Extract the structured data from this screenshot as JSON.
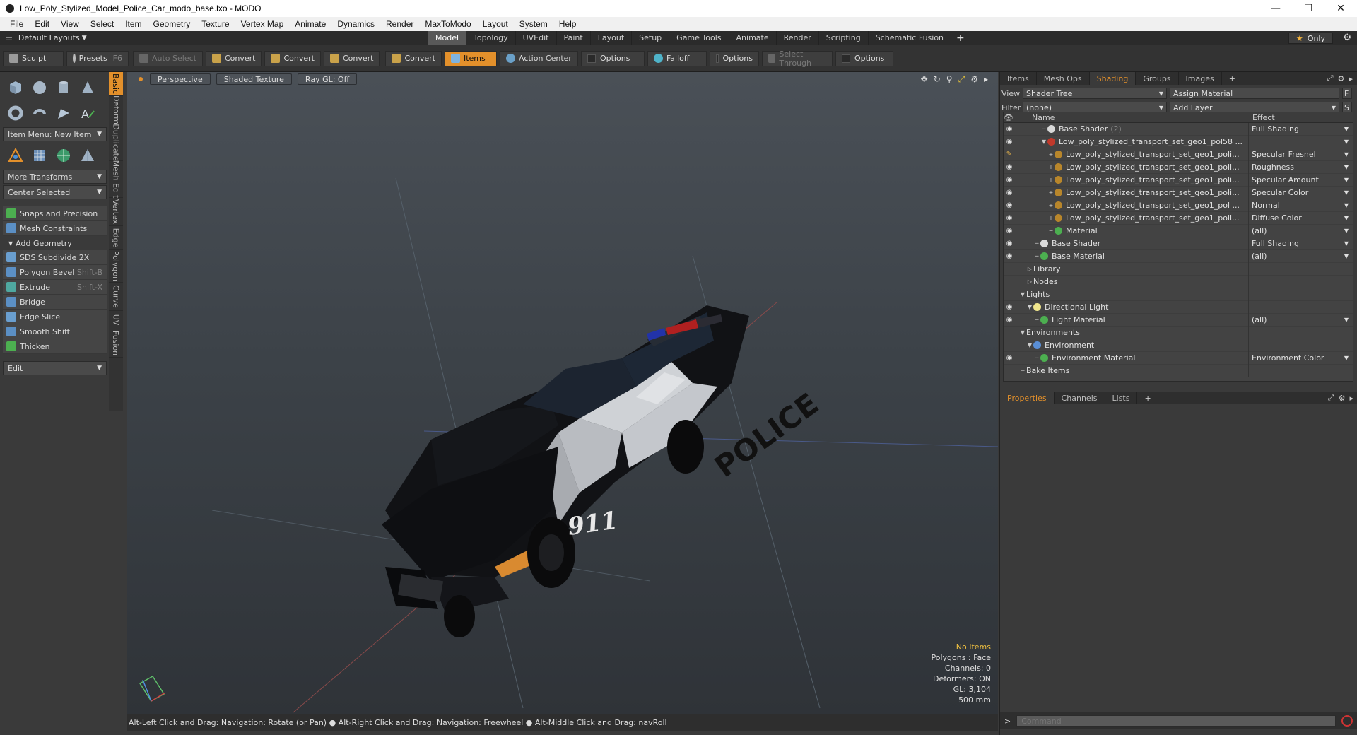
{
  "window": {
    "title": "Low_Poly_Stylized_Model_Police_Car_modo_base.lxo - MODO"
  },
  "menu": [
    "File",
    "Edit",
    "View",
    "Select",
    "Item",
    "Geometry",
    "Texture",
    "Vertex Map",
    "Animate",
    "Dynamics",
    "Render",
    "MaxToModo",
    "Layout",
    "System",
    "Help"
  ],
  "layoutbar": {
    "layouts_label": "Default Layouts",
    "tabs": [
      "Model",
      "Topology",
      "UVEdit",
      "Paint",
      "Layout",
      "Setup",
      "Game Tools",
      "Animate",
      "Render",
      "Scripting",
      "Schematic Fusion"
    ],
    "active_tab": "Model",
    "only_label": "Only"
  },
  "toolbar": {
    "sculpt": "Sculpt",
    "presets": "Presets",
    "presets_key": "F6",
    "auto_select": "Auto Select",
    "convert1": "Convert",
    "convert2": "Convert",
    "convert3": "Convert",
    "convert4": "Convert",
    "items": "Items",
    "action_center": "Action Center",
    "options1": "Options",
    "falloff": "Falloff",
    "options2": "Options",
    "select_through": "Select Through",
    "options3": "Options"
  },
  "leftpanel": {
    "item_menu": "Item Menu: New Item",
    "more_transforms": "More Transforms",
    "center_selected": "Center Selected",
    "snaps": "Snaps and Precision",
    "mesh_constraints": "Mesh Constraints",
    "add_geometry": "Add Geometry",
    "tools": [
      {
        "label": "SDS Subdivide 2X",
        "key": ""
      },
      {
        "label": "Polygon Bevel",
        "key": "Shift-B"
      },
      {
        "label": "Extrude",
        "key": "Shift-X"
      },
      {
        "label": "Bridge",
        "key": ""
      },
      {
        "label": "Edge Slice",
        "key": ""
      },
      {
        "label": "Smooth Shift",
        "key": ""
      },
      {
        "label": "Thicken",
        "key": ""
      }
    ],
    "edit": "Edit",
    "vtabs": [
      "Basic",
      "Deform",
      "Duplicate",
      "Mesh Edit",
      "Vertex",
      "Edge",
      "Polygon",
      "Curve",
      "UV",
      "Fusion"
    ]
  },
  "viewport": {
    "perspective": "Perspective",
    "shaded": "Shaded Texture",
    "raygl": "Ray GL: Off",
    "stats": {
      "items": "No Items",
      "polygons": "Polygons : Face",
      "channels": "Channels: 0",
      "deformers": "Deformers: ON",
      "gl": "GL: 3,104",
      "scale": "500 mm"
    },
    "car_text_police": "POLICE",
    "car_text_911": "911"
  },
  "statusbar": {
    "text": "Alt-Left Click and Drag: Navigation: Rotate (or Pan) ●  Alt-Right Click and Drag: Navigation: Freewheel ●  Alt-Middle Click and Drag: navRoll"
  },
  "rightpanel": {
    "tabs": [
      "Items",
      "Mesh Ops",
      "Shading",
      "Groups",
      "Images"
    ],
    "active_tab": "Shading",
    "view_label": "View",
    "view_value": "Shader Tree",
    "assign_material": "Assign Material",
    "filter_label": "Filter",
    "filter_value": "(none)",
    "add_layer": "Add Layer",
    "col_name": "Name",
    "col_effect": "Effect",
    "tree": [
      {
        "indent": 3,
        "eye": true,
        "exp": "",
        "color": "#d8d8d8",
        "name": "Base Shader",
        "count": "(2)",
        "effect": "Full Shading",
        "arrow": true
      },
      {
        "indent": 3,
        "eye": true,
        "exp": "▼",
        "color": "#c0392b",
        "name": "Low_poly_stylized_transport_set_geo1_pol58 ...",
        "count": "",
        "effect": "",
        "arrow": true
      },
      {
        "indent": 4,
        "eye": "brush",
        "exp": "+",
        "color": "#b8862b",
        "name": "Low_poly_stylized_transport_set_geo1_poli...",
        "count": "",
        "effect": "Specular Fresnel",
        "arrow": true
      },
      {
        "indent": 4,
        "eye": true,
        "exp": "+",
        "color": "#b8862b",
        "name": "Low_poly_stylized_transport_set_geo1_poli...",
        "count": "",
        "effect": "Roughness",
        "arrow": true
      },
      {
        "indent": 4,
        "eye": true,
        "exp": "+",
        "color": "#b8862b",
        "name": "Low_poly_stylized_transport_set_geo1_poli...",
        "count": "",
        "effect": "Specular Amount",
        "arrow": true
      },
      {
        "indent": 4,
        "eye": true,
        "exp": "+",
        "color": "#b8862b",
        "name": "Low_poly_stylized_transport_set_geo1_poli...",
        "count": "",
        "effect": "Specular Color",
        "arrow": true
      },
      {
        "indent": 4,
        "eye": true,
        "exp": "+",
        "color": "#b8862b",
        "name": "Low_poly_stylized_transport_set_geo1_pol ...",
        "count": "",
        "effect": "Normal",
        "arrow": true
      },
      {
        "indent": 4,
        "eye": true,
        "exp": "+",
        "color": "#b8862b",
        "name": "Low_poly_stylized_transport_set_geo1_poli...",
        "count": "",
        "effect": "Diffuse Color",
        "arrow": true
      },
      {
        "indent": 4,
        "eye": true,
        "exp": "",
        "color": "#4caf50",
        "name": "Material",
        "count": "",
        "effect": "(all)",
        "arrow": true
      },
      {
        "indent": 2,
        "eye": true,
        "exp": "",
        "color": "#d8d8d8",
        "name": "Base Shader",
        "count": "",
        "effect": "Full Shading",
        "arrow": true
      },
      {
        "indent": 2,
        "eye": true,
        "exp": "",
        "color": "#4caf50",
        "name": "Base Material",
        "count": "",
        "effect": "(all)",
        "arrow": true
      },
      {
        "indent": 1,
        "eye": false,
        "exp": "▷",
        "color": "",
        "name": "Library",
        "count": "",
        "effect": "",
        "arrow": false
      },
      {
        "indent": 1,
        "eye": false,
        "exp": "▷",
        "color": "",
        "name": "Nodes",
        "count": "",
        "effect": "",
        "arrow": false
      },
      {
        "indent": 0,
        "eye": false,
        "exp": "▼",
        "color": "",
        "name": "Lights",
        "count": "",
        "effect": "",
        "arrow": false
      },
      {
        "indent": 1,
        "eye": true,
        "exp": "▼",
        "color": "#f0e68c",
        "name": "Directional Light",
        "count": "",
        "effect": "",
        "arrow": false
      },
      {
        "indent": 2,
        "eye": true,
        "exp": "",
        "color": "#4caf50",
        "name": "Light Material",
        "count": "",
        "effect": "(all)",
        "arrow": true
      },
      {
        "indent": 0,
        "eye": false,
        "exp": "▼",
        "color": "",
        "name": "Environments",
        "count": "",
        "effect": "",
        "arrow": false
      },
      {
        "indent": 1,
        "eye": false,
        "exp": "▼",
        "color": "#5a8fd6",
        "name": "Environment",
        "count": "",
        "effect": "",
        "arrow": false
      },
      {
        "indent": 2,
        "eye": true,
        "exp": "",
        "color": "#4caf50",
        "name": "Environment Material",
        "count": "",
        "effect": "Environment Color",
        "arrow": true
      },
      {
        "indent": 0,
        "eye": false,
        "exp": "",
        "color": "",
        "name": "Bake Items",
        "count": "",
        "effect": "",
        "arrow": false
      }
    ],
    "props_tabs": [
      "Properties",
      "Channels",
      "Lists"
    ],
    "props_active": "Properties",
    "command_placeholder": "Command"
  }
}
